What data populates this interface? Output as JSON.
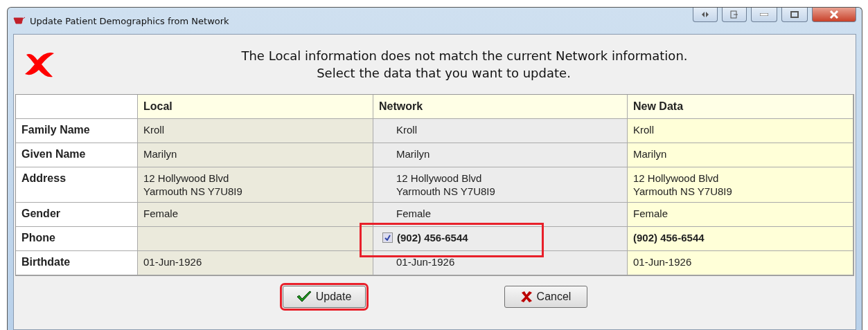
{
  "window": {
    "title": "Update Patient Demographics from Network"
  },
  "message": [
    "The Local information does not match the current Network information.",
    "Select the data that you want to update."
  ],
  "table": {
    "columns": [
      "Local",
      "Network",
      "New Data"
    ],
    "rows": [
      {
        "label": "Family Name",
        "local": [
          "Kroll"
        ],
        "network": [
          "Kroll"
        ],
        "new_data": [
          "Kroll"
        ],
        "emphasized": false,
        "highlighted": false
      },
      {
        "label": "Given Name",
        "local": [
          "Marilyn"
        ],
        "network": [
          "Marilyn"
        ],
        "new_data": [
          "Marilyn"
        ],
        "emphasized": false,
        "highlighted": false
      },
      {
        "label": "Address",
        "local": [
          "12 Hollywood Blvd",
          "Yarmouth NS  Y7U8I9"
        ],
        "network": [
          "12 Hollywood Blvd",
          "Yarmouth NS  Y7U8I9"
        ],
        "new_data": [
          "12 Hollywood Blvd",
          "Yarmouth NS  Y7U8I9"
        ],
        "emphasized": false,
        "highlighted": false
      },
      {
        "label": "Gender",
        "local": [
          "Female"
        ],
        "network": [
          "Female"
        ],
        "new_data": [
          "Female"
        ],
        "emphasized": false,
        "highlighted": false
      },
      {
        "label": "Phone",
        "local": [],
        "network": [
          "(902) 456-6544"
        ],
        "new_data": [
          "(902) 456-6544"
        ],
        "emphasized": true,
        "highlighted": true,
        "checked": true
      },
      {
        "label": "Birthdate",
        "local": [
          "01-Jun-1926"
        ],
        "network": [
          "01-Jun-1926"
        ],
        "new_data": [
          "01-Jun-1926"
        ],
        "emphasized": false,
        "highlighted": false
      }
    ]
  },
  "buttons": [
    {
      "kind": "confirm",
      "label": "Update",
      "highlighted": true
    },
    {
      "kind": "cancel",
      "label": "Cancel",
      "highlighted": false
    }
  ]
}
